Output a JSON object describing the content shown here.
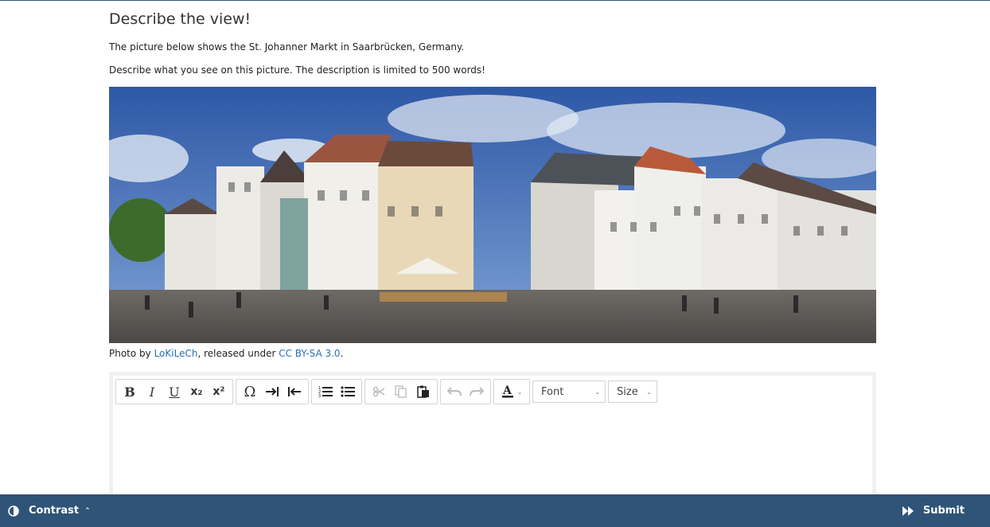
{
  "page": {
    "title": "Describe the view!",
    "intro": "The picture below shows the St. Johanner Markt in Saarbrücken, Germany.",
    "instruction": "Describe what you see on this picture. The description is limited to 500 words!"
  },
  "credit": {
    "prefix": "Photo by ",
    "author": "LoKiLeCh",
    "middle": ", released under ",
    "license": "CC BY-SA 3.0",
    "suffix": "."
  },
  "toolbar": {
    "bold": "B",
    "italic": "I",
    "underline": "U",
    "subscript": "x₂",
    "superscript": "x²",
    "special_char": "Ω",
    "font_label": "Font",
    "size_label": "Size"
  },
  "footer": {
    "contrast_label": "Contrast",
    "submit_label": "Submit"
  },
  "colors": {
    "footer_bg": "#2f5477",
    "link": "#2a6fb5"
  }
}
